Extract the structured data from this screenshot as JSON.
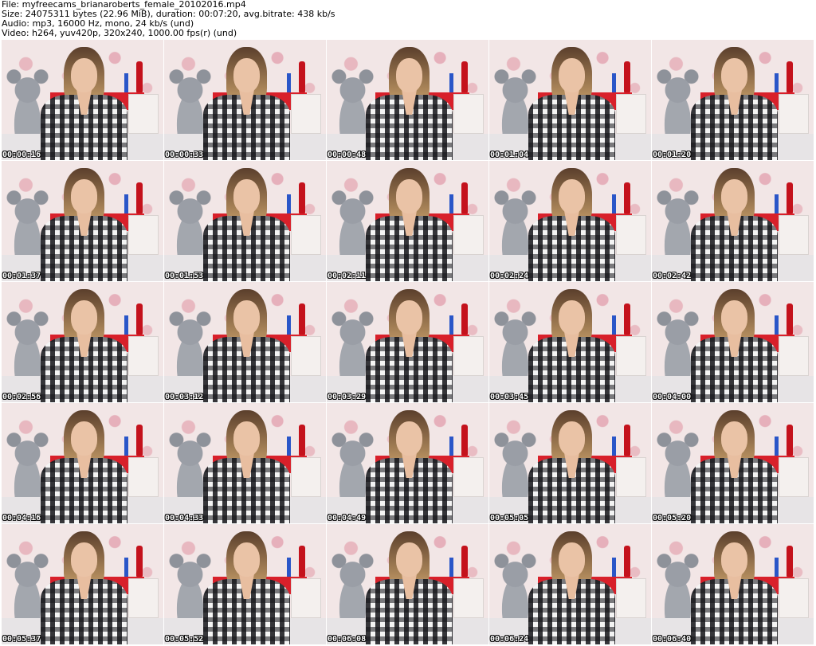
{
  "header": {
    "file": "File: myfreecams_brianaroberts_female_20102016.mp4",
    "size": "Size: 24075311 bytes (22.96 MiB), duration: 00:07:20, avg.bitrate: 438 kb/s",
    "audio": "Audio: mp3, 16000 Hz, mono, 24 kb/s (und)",
    "video": "Video: h264, yuv420p, 320x240, 1000.00 fps(r) (und)"
  },
  "thumbnails": [
    {
      "timestamp": "00:00:16"
    },
    {
      "timestamp": "00:00:33"
    },
    {
      "timestamp": "00:00:48"
    },
    {
      "timestamp": "00:01:04"
    },
    {
      "timestamp": "00:01:20"
    },
    {
      "timestamp": "00:01:37"
    },
    {
      "timestamp": "00:01:53"
    },
    {
      "timestamp": "00:02:11"
    },
    {
      "timestamp": "00:02:24"
    },
    {
      "timestamp": "00:02:42"
    },
    {
      "timestamp": "00:02:56"
    },
    {
      "timestamp": "00:03:12"
    },
    {
      "timestamp": "00:03:29"
    },
    {
      "timestamp": "00:03:45"
    },
    {
      "timestamp": "00:04:00"
    },
    {
      "timestamp": "00:04:16"
    },
    {
      "timestamp": "00:04:33"
    },
    {
      "timestamp": "00:04:49"
    },
    {
      "timestamp": "00:05:05"
    },
    {
      "timestamp": "00:05:20"
    },
    {
      "timestamp": "00:05:37"
    },
    {
      "timestamp": "00:05:52"
    },
    {
      "timestamp": "00:06:08"
    },
    {
      "timestamp": "00:06:24"
    },
    {
      "timestamp": "00:06:40"
    }
  ]
}
